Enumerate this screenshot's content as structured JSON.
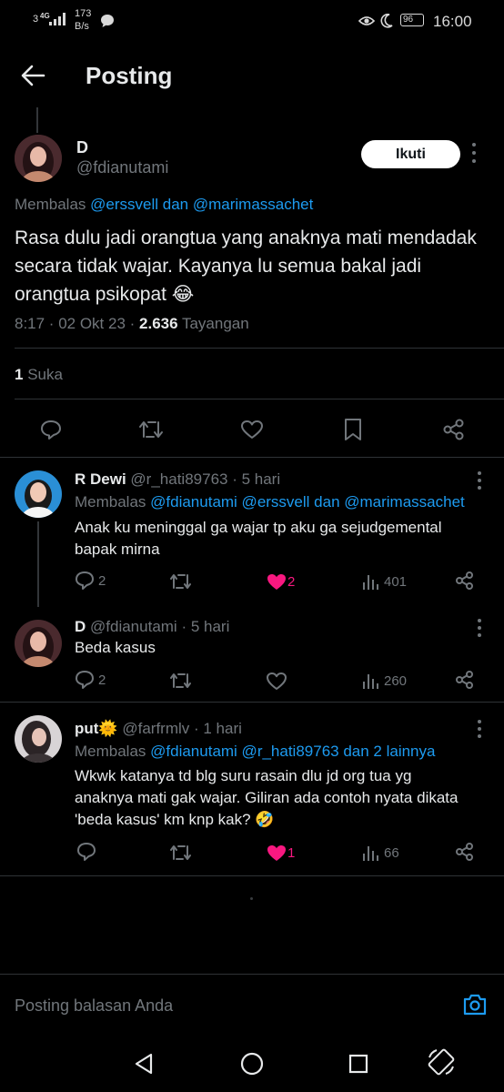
{
  "status_bar": {
    "signal": "3",
    "network": "4G",
    "speed_value": "173",
    "speed_unit": "B/s",
    "battery": "96",
    "time": "16:00"
  },
  "header": {
    "title": "Posting"
  },
  "main_post": {
    "display_name": "D",
    "handle": "@fdianutami",
    "follow_label": "Ikuti",
    "reply_prefix": "Membalas",
    "reply_to": "@erssvell dan @marimassachet",
    "text": "Rasa dulu jadi orangtua yang anaknya mati mendadak secara tidak wajar. Kayanya lu semua bakal jadi orangtua psikopat 😂",
    "text_lines": [
      "Rasa dulu jadi orangtua yang anaknya mati mendadak",
      "secara tidak wajar. Kayanya lu semua bakal jadi",
      "orangtua psikopat 😂"
    ],
    "timestamp": "8:17 · 02 Okt 23 · ",
    "views_count": "2.636",
    "views_label": " Tayangan",
    "likes_count": "1",
    "likes_label": " Suka"
  },
  "replies": [
    {
      "display_name": "R Dewi",
      "handle": "@r_hati89763",
      "time": " · 5 hari",
      "reply_prefix": "Membalas ",
      "reply_to": "@fdianutami @erssvell dan @marimassachet",
      "text_lines": [
        "Anak ku meninggal ga wajar tp aku ga sejudgemental",
        "bapak mirna"
      ],
      "replies": "2",
      "likes": "2",
      "liked": true,
      "views": "401"
    },
    {
      "display_name": "D",
      "handle": "@fdianutami",
      "time": " · 5 hari",
      "reply_prefix": "",
      "reply_to": "",
      "text_lines": [
        "Beda kasus"
      ],
      "replies": "2",
      "likes": "",
      "liked": false,
      "views": "260"
    },
    {
      "display_name": "put🌞",
      "handle": "@farfrmlv",
      "time": " · 1 hari",
      "reply_prefix": "Membalas ",
      "reply_to": "@fdianutami @r_hati89763 dan 2 lainnya",
      "text_lines": [
        "Wkwk katanya td blg suru rasain dlu jd org tua yg",
        "anaknya mati gak wajar. Giliran ada contoh nyata dikata",
        "'beda kasus' km knp kak? 🤣"
      ],
      "replies": "",
      "likes": "1",
      "liked": true,
      "views": "66"
    }
  ],
  "composer": {
    "placeholder": "Posting balasan Anda"
  },
  "colors": {
    "accent": "#1d9bf0",
    "like": "#f91880",
    "background": "#000000",
    "muted": "#71767b"
  },
  "icons": [
    "back-arrow-icon",
    "reply-icon",
    "retweet-icon",
    "like-icon",
    "bookmark-icon",
    "share-icon",
    "more-icon",
    "views-icon",
    "camera-icon"
  ]
}
